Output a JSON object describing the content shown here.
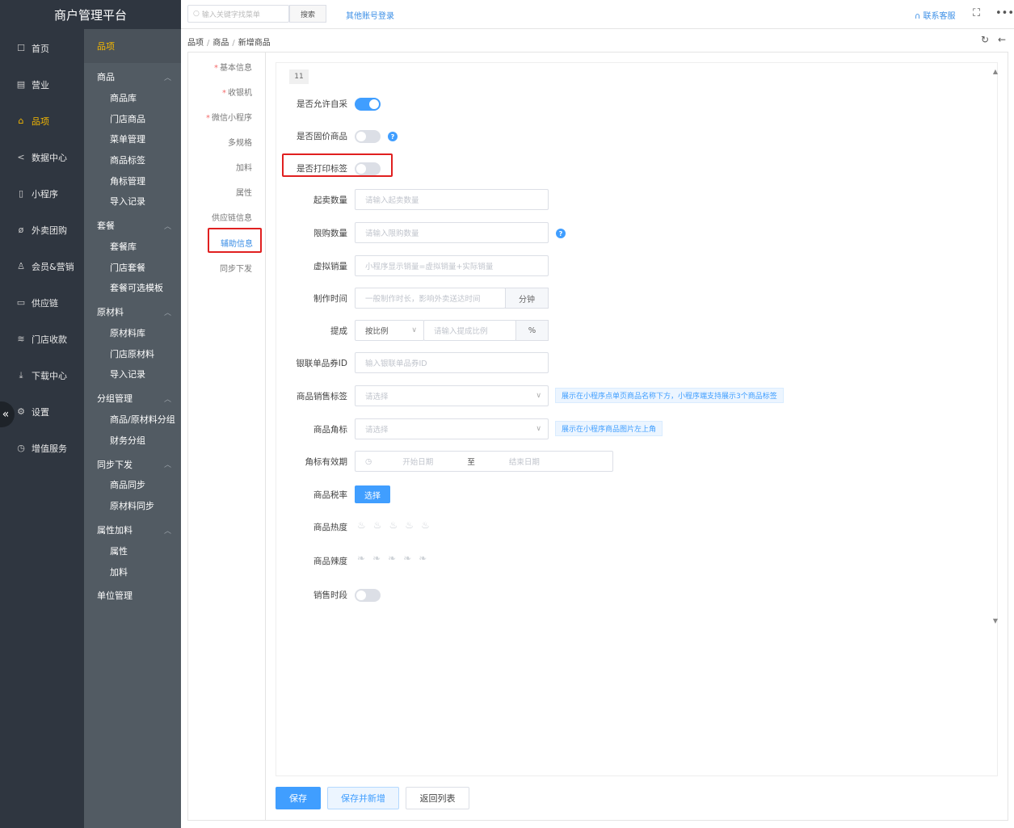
{
  "app": {
    "title": "商户管理平台"
  },
  "nav": [
    {
      "label": "首页",
      "icon": "home-icon",
      "glyph": "☐"
    },
    {
      "label": "营业",
      "icon": "calendar-icon",
      "glyph": "▤"
    },
    {
      "label": "品项",
      "icon": "bag-icon",
      "glyph": "⌂",
      "active": true
    },
    {
      "label": "数据中心",
      "icon": "share-icon",
      "glyph": "<"
    },
    {
      "label": "小程序",
      "icon": "phone-icon",
      "glyph": "▯"
    },
    {
      "label": "外卖团购",
      "icon": "bike-icon",
      "glyph": "ø"
    },
    {
      "label": "会员&营销",
      "icon": "user-icon",
      "glyph": "♙"
    },
    {
      "label": "供应链",
      "icon": "truck-icon",
      "glyph": "▭"
    },
    {
      "label": "门店收款",
      "icon": "database-icon",
      "glyph": "≋"
    },
    {
      "label": "下载中心",
      "icon": "download-icon",
      "glyph": "⤓"
    },
    {
      "label": "设置",
      "icon": "gear-icon",
      "glyph": "⚙"
    },
    {
      "label": "增值服务",
      "icon": "alarm-icon",
      "glyph": "◷"
    }
  ],
  "subnav": {
    "head": "品项",
    "groups": [
      {
        "label": "商品",
        "items": [
          "商品库",
          "门店商品",
          "菜单管理",
          "商品标签",
          "角标管理",
          "导入记录"
        ]
      },
      {
        "label": "套餐",
        "items": [
          "套餐库",
          "门店套餐",
          "套餐可选模板"
        ]
      },
      {
        "label": "原材料",
        "items": [
          "原材料库",
          "门店原材料",
          "导入记录"
        ]
      },
      {
        "label": "分组管理",
        "items": [
          "商品/原材料分组",
          "财务分组"
        ]
      },
      {
        "label": "同步下发",
        "items": [
          "商品同步",
          "原材料同步"
        ]
      },
      {
        "label": "属性加料",
        "items": [
          "属性",
          "加料"
        ]
      },
      {
        "label": "单位管理",
        "items": []
      }
    ]
  },
  "topbar": {
    "search_placeholder": "输入关键字找菜单",
    "search_button": "搜索",
    "other_login": "其他账号登录",
    "customer_service": "联系客服"
  },
  "breadcrumb": [
    "品项",
    "商品",
    "新增商品"
  ],
  "tabs": [
    {
      "label": "基本信息",
      "required": true
    },
    {
      "label": "收银机",
      "required": true
    },
    {
      "label": "微信小程序",
      "required": true
    },
    {
      "label": "多规格",
      "required": false
    },
    {
      "label": "加料",
      "required": false
    },
    {
      "label": "属性",
      "required": false
    },
    {
      "label": "供应链信息",
      "required": false
    },
    {
      "label": "辅助信息",
      "required": false,
      "active": true
    },
    {
      "label": "同步下发",
      "required": false
    }
  ],
  "form": {
    "badge": "11",
    "allow_self_pick": {
      "label": "是否允许自采",
      "on": true
    },
    "fixed_price": {
      "label": "是否固价商品",
      "on": false
    },
    "print_label": {
      "label": "是否打印标签",
      "on": false
    },
    "min_sale": {
      "label": "起卖数量",
      "placeholder": "请输入起卖数量"
    },
    "limit_buy": {
      "label": "限购数量",
      "placeholder": "请输入限购数量"
    },
    "virtual_sales": {
      "label": "虚拟销量",
      "placeholder": "小程序显示销量=虚拟销量+实际销量"
    },
    "make_time": {
      "label": "制作时间",
      "placeholder": "一般制作时长，影响外卖送达时间",
      "unit": "分钟"
    },
    "commission": {
      "label": "提成",
      "mode": "按比例",
      "placeholder": "请输入提成比例",
      "unit": "%"
    },
    "unionpay_id": {
      "label": "银联单品券ID",
      "placeholder": "输入银联单品券ID"
    },
    "sale_tags": {
      "label": "商品销售标签",
      "placeholder": "请选择",
      "tip": "展示在小程序点单页商品名称下方，小程序端支持展示3个商品标签"
    },
    "corner_mark": {
      "label": "商品角标",
      "placeholder": "请选择",
      "tip": "展示在小程序商品图片左上角"
    },
    "corner_validity": {
      "label": "角标有效期",
      "start": "开始日期",
      "to": "至",
      "end": "结束日期"
    },
    "tax_rate": {
      "label": "商品税率",
      "button": "选择"
    },
    "heat": {
      "label": "商品热度",
      "value": 0,
      "max": 5
    },
    "spicy": {
      "label": "商品辣度",
      "value": 0,
      "max": 5
    },
    "sale_period": {
      "label": "销售时段",
      "on": false
    }
  },
  "footer": {
    "save": "保存",
    "save_new": "保存并新增",
    "back": "返回列表"
  },
  "colors": {
    "accent": "#409eff",
    "nav_active": "#f5b800",
    "sidebar": "#2f3640",
    "highlight": "#e02020"
  }
}
